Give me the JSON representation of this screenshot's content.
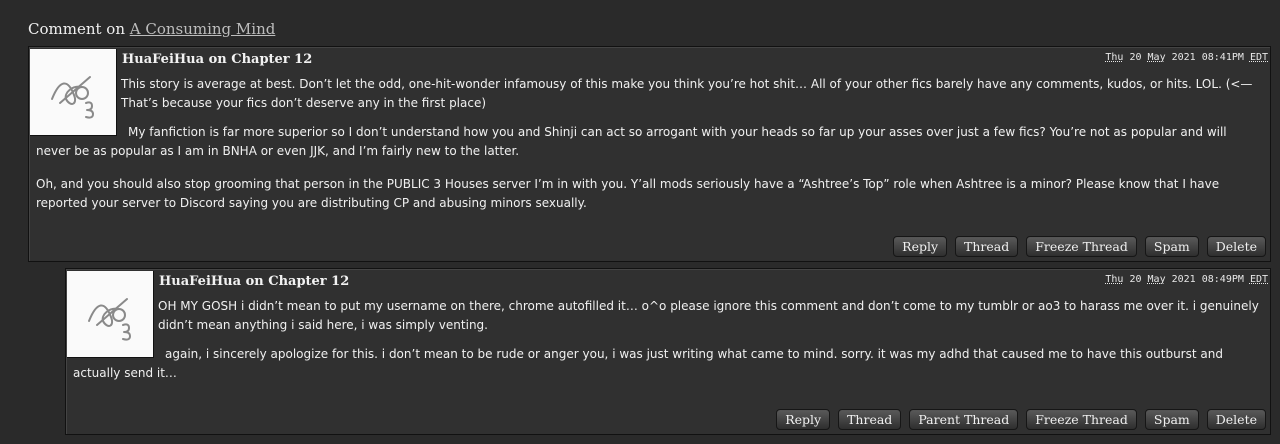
{
  "heading": {
    "prefix": "Comment on ",
    "work_link": "A Consuming Mind"
  },
  "comments": [
    {
      "author_line": "HuaFeiHua on Chapter 12",
      "date": {
        "dow": "Thu",
        "day": "20",
        "month": "May",
        "year": "2021",
        "time": "08:41PM",
        "tz": "EDT"
      },
      "paragraphs": [
        "This story is average at best. Don’t let the odd, one-hit-wonder infamousy of this make you think you’re hot shit… All of your other fics barely have any comments, kudos, or hits. LOL. (<— That’s because your fics don’t deserve any in the first place)",
        "My fanfiction is far more superior so I don’t understand how you and Shinji can act so arrogant with your heads so far up your asses over just a few fics? You’re not as popular and will never be as popular as I am in BNHA or even JJK, and I’m fairly new to the latter.",
        "Oh, and you should also stop grooming that person in the PUBLIC 3 Houses server I’m in with you. Y’all mods seriously have a “Ashtree’s Top” role when Ashtree is a minor? Please know that I have reported your server to Discord saying you are distributing CP and abusing minors sexually."
      ],
      "actions": [
        "Reply",
        "Thread",
        "Freeze Thread",
        "Spam",
        "Delete"
      ]
    },
    {
      "author_line": "HuaFeiHua on Chapter 12",
      "date": {
        "dow": "Thu",
        "day": "20",
        "month": "May",
        "year": "2021",
        "time": "08:49PM",
        "tz": "EDT"
      },
      "paragraphs": [
        "OH MY GOSH i didn’t mean to put my username on there, chrome autofilled it… o^o please ignore this comment and don’t come to my tumblr or ao3 to harass me over it. i genuinely didn’t mean anything i said here, i was simply venting.",
        "again, i sincerely apologize for this. i don’t mean to be rude or anger you, i was just writing what came to mind. sorry. it was my adhd that caused me to have this outburst and actually send it…"
      ],
      "actions": [
        "Reply",
        "Thread",
        "Parent Thread",
        "Freeze Thread",
        "Spam",
        "Delete"
      ]
    }
  ]
}
